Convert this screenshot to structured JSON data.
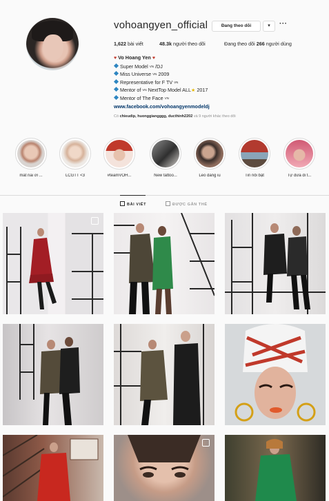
{
  "profile": {
    "username": "vohoangyen_official",
    "follow_button": "Đang theo dõi",
    "dropdown_glyph": "▾",
    "more_glyph": "···",
    "stats": {
      "posts_count": "1,622",
      "posts_label": "bài viết",
      "followers_count": "48.3k",
      "followers_label": "người theo dõi",
      "following_prefix": "Đang theo dõi",
      "following_count": "266",
      "following_suffix": "người dùng"
    },
    "bio": {
      "name": "Vo Hoang Yen",
      "line1_a": "Super Model",
      "line1_flag": "VN",
      "line1_b": "/DJ",
      "line2_a": "Miss Universe",
      "line2_flag": "VN",
      "line2_b": "2009",
      "line3_a": "Representative for F TV",
      "line3_flag": "VN",
      "line4_a": "Mentor of",
      "line4_flag": "VN",
      "line4_b": "NextTop Model ALL",
      "line4_star": "★",
      "line4_c": "2017",
      "line5_a": "Mentor of The Face",
      "line5_flag": "VN",
      "link": "www.facebook.com/vohoangyenmodeldj"
    },
    "followed_by": {
      "prefix": "Có",
      "names": "chieudip, huonggiangggg, ducthinh2202",
      "suffix": "và 9 người khác theo dõi"
    }
  },
  "highlights": [
    {
      "label": "mất nai ơi ..."
    },
    {
      "label": "LCGTT <3"
    },
    {
      "label": "#teamVOH..."
    },
    {
      "label": "New tattoo..."
    },
    {
      "label": "Leo dang iu"
    },
    {
      "label": "Tin nổi bật"
    },
    {
      "label": "Tự đưa đi t..."
    }
  ],
  "tabs": [
    {
      "label": "BÀI VIẾT"
    },
    {
      "label": "ĐƯỢC GẮN THẺ"
    }
  ],
  "colors": {
    "link": "#003569",
    "muted": "#8e8e8e",
    "border": "#dbdbdb",
    "text": "#262626"
  }
}
